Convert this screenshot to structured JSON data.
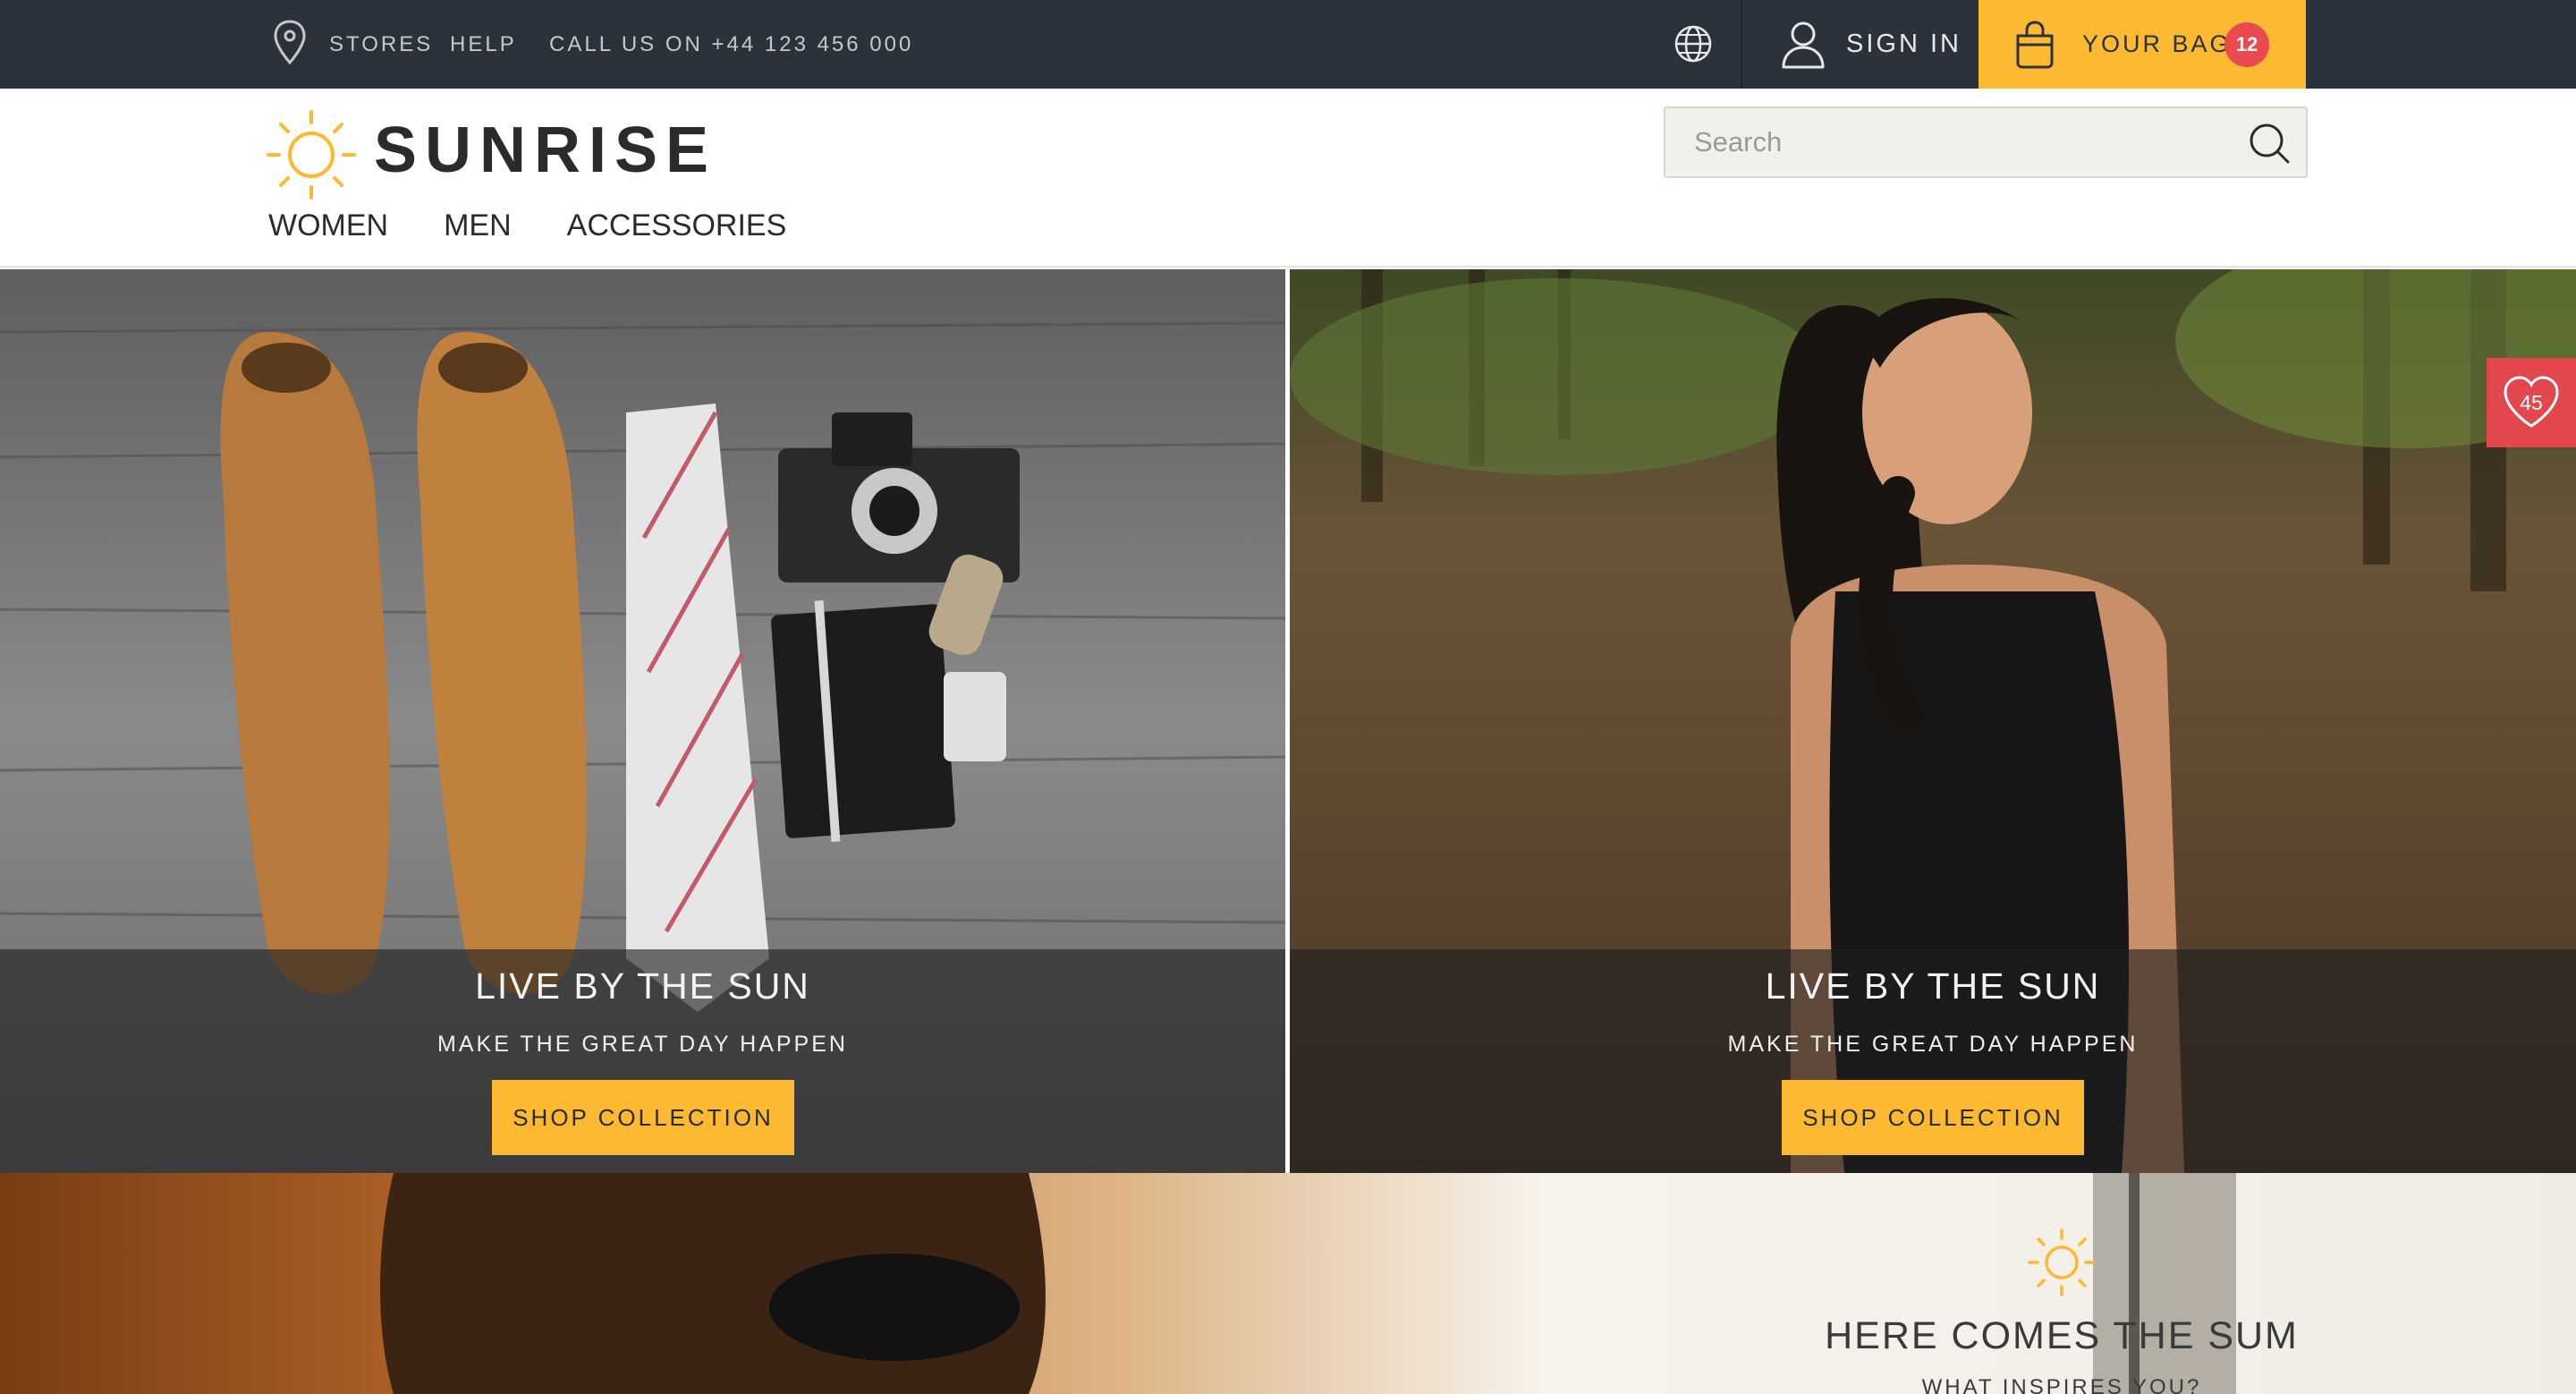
{
  "topbar": {
    "stores": "STORES",
    "help": "HELP",
    "call": "CALL US ON +44 123 456 000",
    "sign_in": "SIGN IN",
    "bag_label": "YOUR BAG",
    "bag_count": "12"
  },
  "header": {
    "logo_text": "SUNRISE",
    "search_placeholder": "Search",
    "nav": [
      "WOMEN",
      "MEN",
      "ACCESSORIES"
    ]
  },
  "hero": {
    "left": {
      "title": "LIVE BY THE SUN",
      "subtitle": "MAKE THE GREAT DAY HAPPEN",
      "button": "SHOP COLLECTION"
    },
    "right": {
      "title": "LIVE BY THE SUN",
      "subtitle": "MAKE THE GREAT DAY HAPPEN",
      "button": "SHOP COLLECTION"
    }
  },
  "wishlist": {
    "count": "45"
  },
  "promo": {
    "title": "HERE COMES THE SUM",
    "subtitle": "WHAT INSPIRES YOU?"
  },
  "colors": {
    "topbar_bg": "#2b323b",
    "accent_yellow": "#fcb931",
    "accent_red": "#e2474d"
  },
  "icons": [
    "pin-icon",
    "globe-icon",
    "user-icon",
    "bag-icon",
    "sun-logo-icon",
    "search-icon",
    "heart-icon",
    "sun-icon"
  ]
}
